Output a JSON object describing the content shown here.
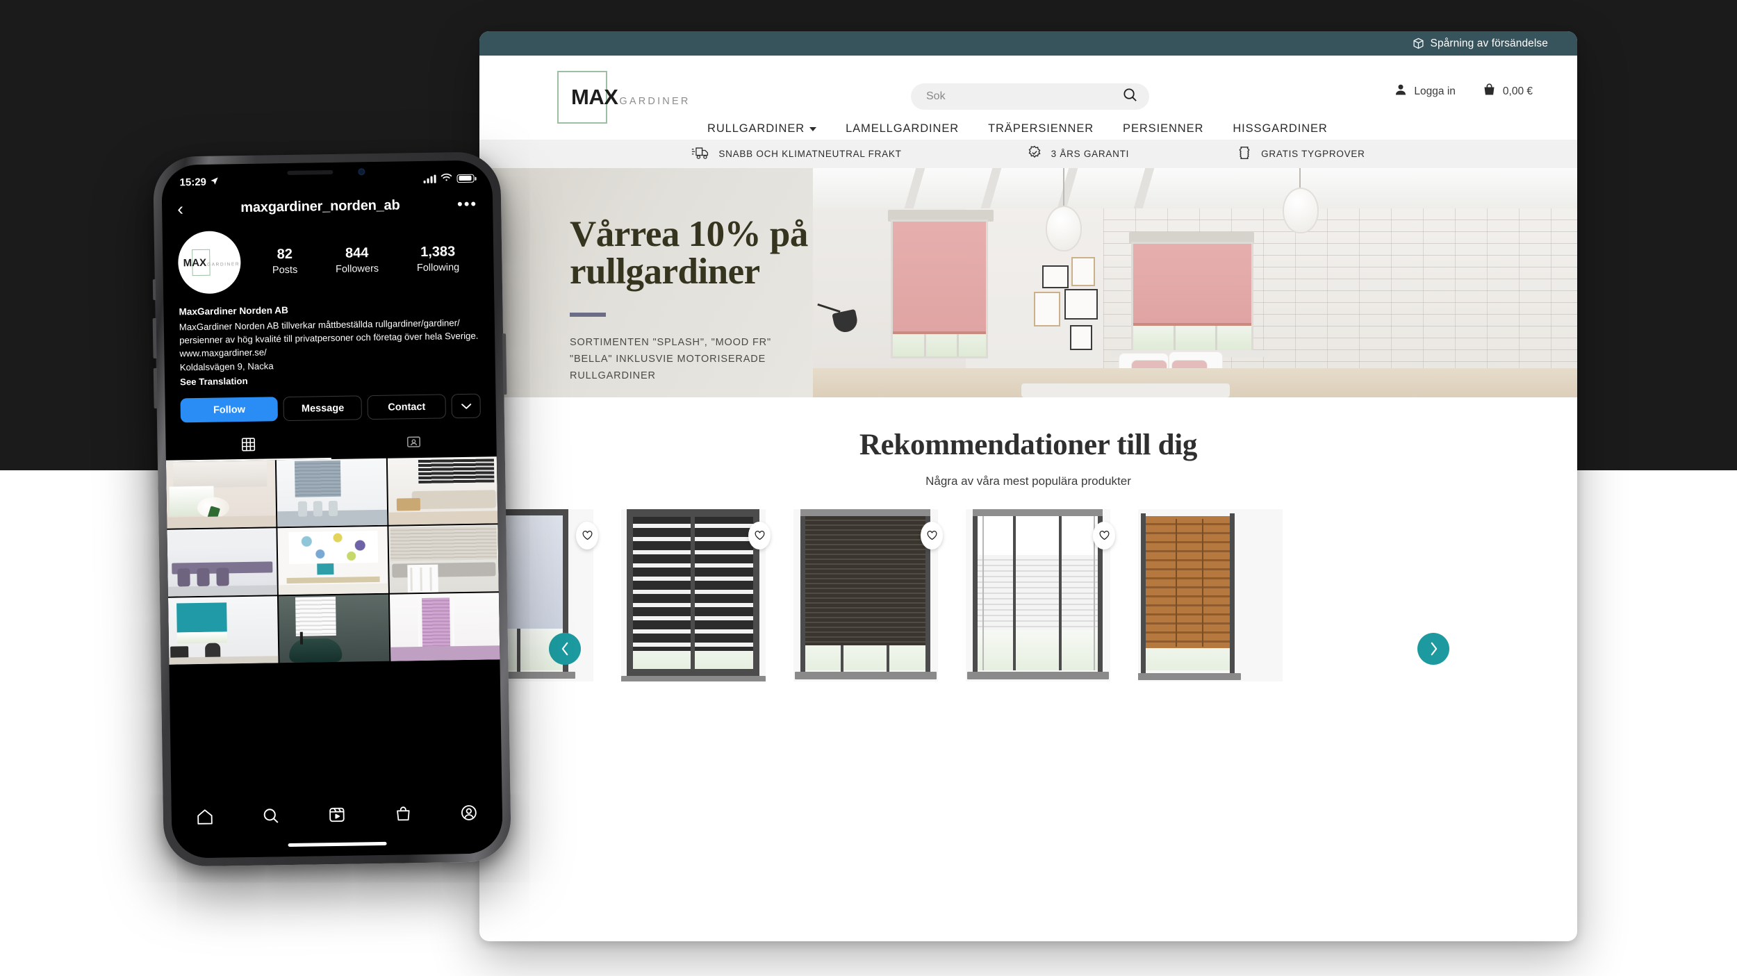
{
  "background": {
    "top_color": "#1b1b1b",
    "bottom_color": "#ffffff"
  },
  "browser": {
    "topbar": {
      "tracking_label": "Spårning av försändelse",
      "icon": "package-icon",
      "bg": "#37535c"
    },
    "header": {
      "logo": {
        "max": "MAX",
        "gardiner": "GARDINER",
        "frame_color": "#9cbfa2"
      },
      "search": {
        "placeholder": "Sok",
        "value": "",
        "icon": "search-icon"
      },
      "account": {
        "login_label": "Logga in",
        "login_icon": "user-icon",
        "cart_total": "0,00 €",
        "cart_icon": "shopping-bag-icon"
      },
      "nav": [
        {
          "label": "RULLGARDINER",
          "has_dropdown": true
        },
        {
          "label": "LAMELLGARDINER",
          "has_dropdown": false
        },
        {
          "label": "TRÄPERSIENNER",
          "has_dropdown": false
        },
        {
          "label": "PERSIENNER",
          "has_dropdown": false
        },
        {
          "label": "HISSGARDINER",
          "has_dropdown": false
        }
      ]
    },
    "benefits": [
      {
        "label": "SNABB OCH KLIMATNEUTRAL FRAKT",
        "icon": "truck-icon"
      },
      {
        "label": "3 ÅRS GARANTI",
        "icon": "badge-check-icon"
      },
      {
        "label": "GRATIS TYGPROVER",
        "icon": "fabric-swatch-icon"
      }
    ],
    "hero": {
      "title_line1": "Vårrea 10% på",
      "title_line2": "rullgardiner",
      "rule_color": "#6a6d85",
      "subtitle_line1": "SORTIMENTEN \"SPLASH\", \"MOOD FR\"",
      "subtitle_line2": "\"BELLA\" INKLUSVIE MOTORISERADE",
      "subtitle_line3": "RULLGARDINER",
      "image_alt": "Bedroom with pink roller blinds"
    },
    "recommendations": {
      "heading": "Rekommendationer till dig",
      "subheading": "Några av våra mest populära produkter",
      "prev_label": "‹",
      "next_label": "›",
      "arrow_color": "#1c9a9f",
      "products": [
        {
          "name": "white-roller-blind",
          "favorite_icon": "heart-icon",
          "partial": true
        },
        {
          "name": "black-zebra-blind",
          "favorite_icon": "heart-icon",
          "partial": false
        },
        {
          "name": "dark-pleated-blind",
          "favorite_icon": "heart-icon",
          "partial": false
        },
        {
          "name": "white-pleated-blind",
          "favorite_icon": "heart-icon",
          "partial": false
        },
        {
          "name": "wooden-venetian-blind",
          "favorite_icon": "heart-icon",
          "partial": true
        }
      ]
    }
  },
  "phone": {
    "statusbar": {
      "time": "15:29",
      "location_icon": "location-arrow-icon",
      "signal_icon": "cellular-bars-icon",
      "wifi_icon": "wifi-icon",
      "battery_icon": "battery-icon"
    },
    "instagram": {
      "nav": {
        "back_icon": "chevron-left-icon",
        "title": "maxgardiner_norden_ab",
        "more_icon": "ellipsis-icon"
      },
      "avatar": {
        "max": "MAX",
        "gardiner": "GARDINER"
      },
      "stats": [
        {
          "number": "82",
          "label": "Posts"
        },
        {
          "number": "844",
          "label": "Followers"
        },
        {
          "number": "1,383",
          "label": "Following"
        }
      ],
      "bio": {
        "name": "MaxGardiner Norden AB",
        "line1": "MaxGardiner Norden AB tillverkar måttbeställda rullgardiner/gardiner/",
        "line2": "persienner av hög kvalité till privatpersoner och företag över hela Sverige.",
        "website": "www.maxgardiner.se/",
        "address": "Koldalsvägen 9, Nacka",
        "translate": "See Translation"
      },
      "actions": [
        {
          "label": "Follow",
          "style": "primary",
          "color": "#2a8cf5"
        },
        {
          "label": "Message",
          "style": "secondary"
        },
        {
          "label": "Contact",
          "style": "secondary"
        },
        {
          "label": "",
          "style": "chevron",
          "icon": "chevron-down-icon"
        }
      ],
      "tabs": [
        {
          "icon": "grid-icon",
          "active": true
        },
        {
          "icon": "tagged-person-icon",
          "active": false
        }
      ],
      "grid": [
        {
          "name": "post-flowers-window"
        },
        {
          "name": "post-blue-pleated-blind"
        },
        {
          "name": "post-living-room-zebra"
        },
        {
          "name": "post-office-meeting-room"
        },
        {
          "name": "post-floral-roller-blind"
        },
        {
          "name": "post-bay-window-seat"
        },
        {
          "name": "post-teal-office-blind"
        },
        {
          "name": "post-bathroom-venetian"
        },
        {
          "name": "post-purple-bedroom-blind"
        }
      ],
      "tabbar": [
        {
          "icon": "home-icon"
        },
        {
          "icon": "search-icon"
        },
        {
          "icon": "reels-icon"
        },
        {
          "icon": "shop-bag-icon"
        },
        {
          "icon": "profile-icon"
        }
      ]
    }
  }
}
